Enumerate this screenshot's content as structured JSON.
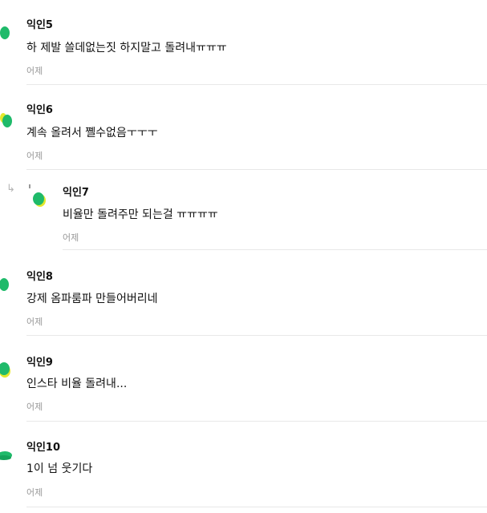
{
  "comments": [
    {
      "author": "익인5",
      "text": "하 제발 쓸데없는짓 하지말고 돌려내ㅠㅠㅠ",
      "date": "어제"
    },
    {
      "author": "익인6",
      "text": "계속 올려서 쪨수없음ㅜㅜㅜ",
      "date": "어제"
    },
    {
      "author": "익인7",
      "text": "비율만 돌려주만 되는걸 ㅠㅠㅠㅠ",
      "date": "어제"
    },
    {
      "author": "익인8",
      "text": "강제 옴파룸파 만들어버리네",
      "date": "어제"
    },
    {
      "author": "익인9",
      "text": "인스타 비율 돌려내...",
      "date": "어제"
    },
    {
      "author": "익인10",
      "text": "1이 넘 웃기다",
      "date": "어제"
    }
  ],
  "icons": {
    "reply": "reply-arrow-icon",
    "avatar": "avatar-icon"
  },
  "colors": {
    "avatar_green": "#1fba6a",
    "avatar_yellow": "#e3e82c",
    "divider": "#e8e8e8",
    "meta": "#999999"
  }
}
